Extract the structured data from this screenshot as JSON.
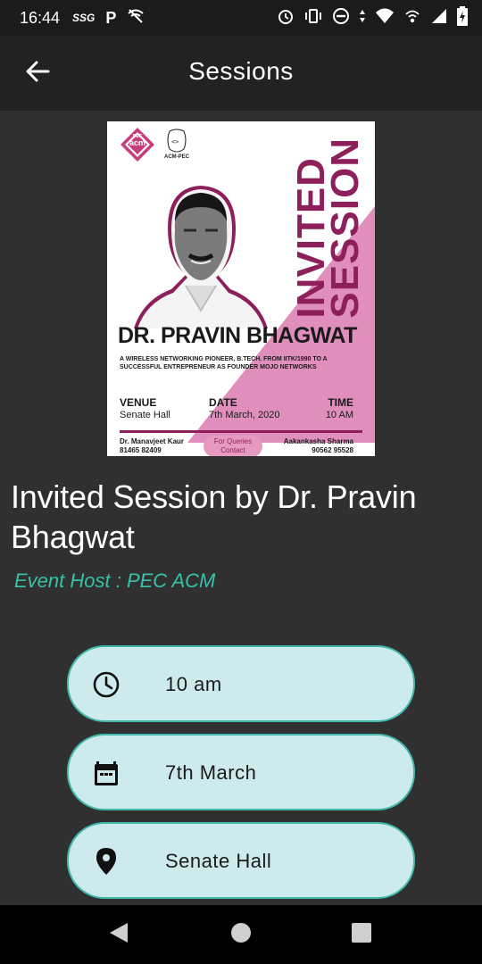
{
  "status_bar": {
    "time": "16:44",
    "left_icons": [
      "ssg-icon",
      "parking-icon",
      "wifi-off-icon"
    ],
    "right_icons": [
      "alarm-icon",
      "vibrate-icon",
      "do-not-disturb-icon",
      "data-arrows-icon",
      "wifi-icon",
      "hotspot-icon",
      "signal-icon",
      "battery-charging-icon"
    ],
    "ssg_label": "SSG",
    "p_label": "P"
  },
  "app_bar": {
    "title": "Sessions",
    "back_icon": "arrow-left-icon"
  },
  "poster": {
    "org_badge_top": "PEC",
    "org_badge_bottom": "acm",
    "chapter_label": "ACM-PEC",
    "vertical_title_line1": "INVITED",
    "vertical_title_line2": "SESSION",
    "speaker_name": "DR. PRAVIN BHAGWAT",
    "description": "A WIRELESS NETWORKING PIONEER, B.TECH. FROM IITK/1990 TO A SUCCESSFUL ENTREPRENEUR AS FOUNDER MOJO NETWORKS",
    "venue_label": "VENUE",
    "venue_value": "Senate Hall",
    "date_label": "DATE",
    "date_value": "7th March, 2020",
    "time_label": "TIME",
    "time_value": "10 AM",
    "contact_left_name": "Dr. Manavjeet Kaur",
    "contact_left_phone": "81465 82409",
    "queries_line1": "For Queries",
    "queries_line2": "Contact",
    "contact_right_name": "Aakankasha Sharma",
    "contact_right_phone": "90562 95528",
    "accent_color": "#8d1f5a",
    "pink_color": "#e08fbc"
  },
  "event": {
    "title": "Invited Session by Dr. Pravin Bhagwat",
    "host": "Event Host : PEC ACM"
  },
  "details": [
    {
      "icon": "clock-icon",
      "label": "10 am"
    },
    {
      "icon": "calendar-icon",
      "label": "7th March"
    },
    {
      "icon": "location-pin-icon",
      "label": "Senate Hall"
    }
  ],
  "nav_bar": {
    "icons": [
      "back-triangle-icon",
      "home-circle-icon",
      "recents-square-icon"
    ]
  },
  "colors": {
    "background": "#303030",
    "app_bar": "#222222",
    "host_text": "#36c1a8",
    "pill_fill": "#cdeaec",
    "pill_border": "#42b9aa"
  }
}
